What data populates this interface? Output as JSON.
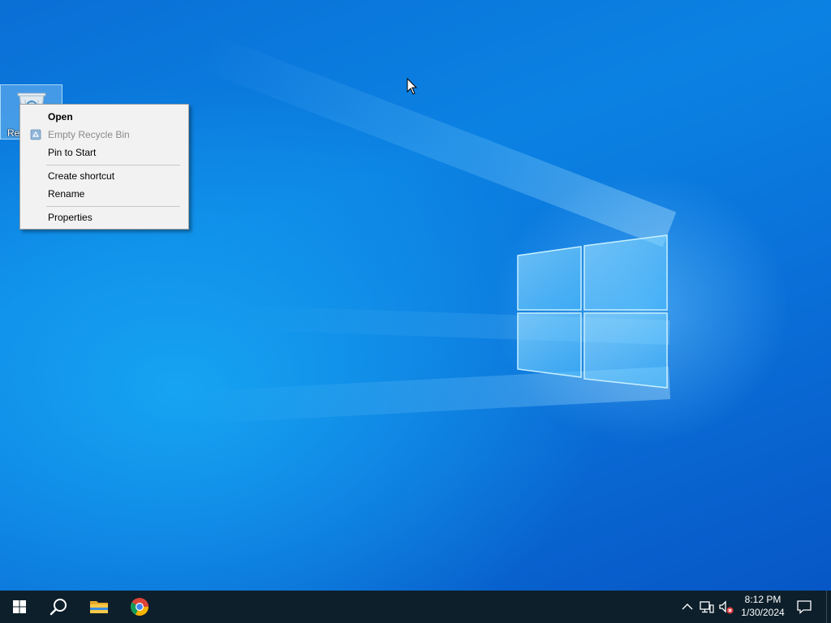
{
  "desktop": {
    "icons": [
      {
        "label": "Recycle Bin",
        "visible_label": "Re",
        "icon": "recycle-bin-icon"
      }
    ]
  },
  "context_menu": {
    "items": [
      {
        "label": "Open",
        "bold": true,
        "disabled": false
      },
      {
        "label": "Empty Recycle Bin",
        "bold": false,
        "disabled": true,
        "icon": "recycle-shield-icon"
      },
      {
        "label": "Pin to Start",
        "bold": false,
        "disabled": false
      },
      {
        "label": "Create shortcut",
        "bold": false,
        "disabled": false
      },
      {
        "label": "Rename",
        "bold": false,
        "disabled": false
      },
      {
        "label": "Properties",
        "bold": false,
        "disabled": false
      }
    ]
  },
  "taskbar": {
    "start_icon": "windows-start-icon",
    "search_icon": "search-icon",
    "pinned": [
      {
        "name": "File Explorer",
        "icon": "folder-icon"
      },
      {
        "name": "Google Chrome",
        "icon": "chrome-icon"
      }
    ],
    "tray": {
      "chevron_icon": "chevron-up-icon",
      "network_icon": "network-icon",
      "volume_icon": "volume-muted-icon"
    },
    "clock": {
      "time": "8:12 PM",
      "date": "1/30/2024"
    },
    "notification_icon": "notification-icon"
  },
  "colors": {
    "desktop_accent": "#0a78dc",
    "taskbar_bg": "#0d1f2b",
    "menu_bg": "#f2f2f2"
  }
}
